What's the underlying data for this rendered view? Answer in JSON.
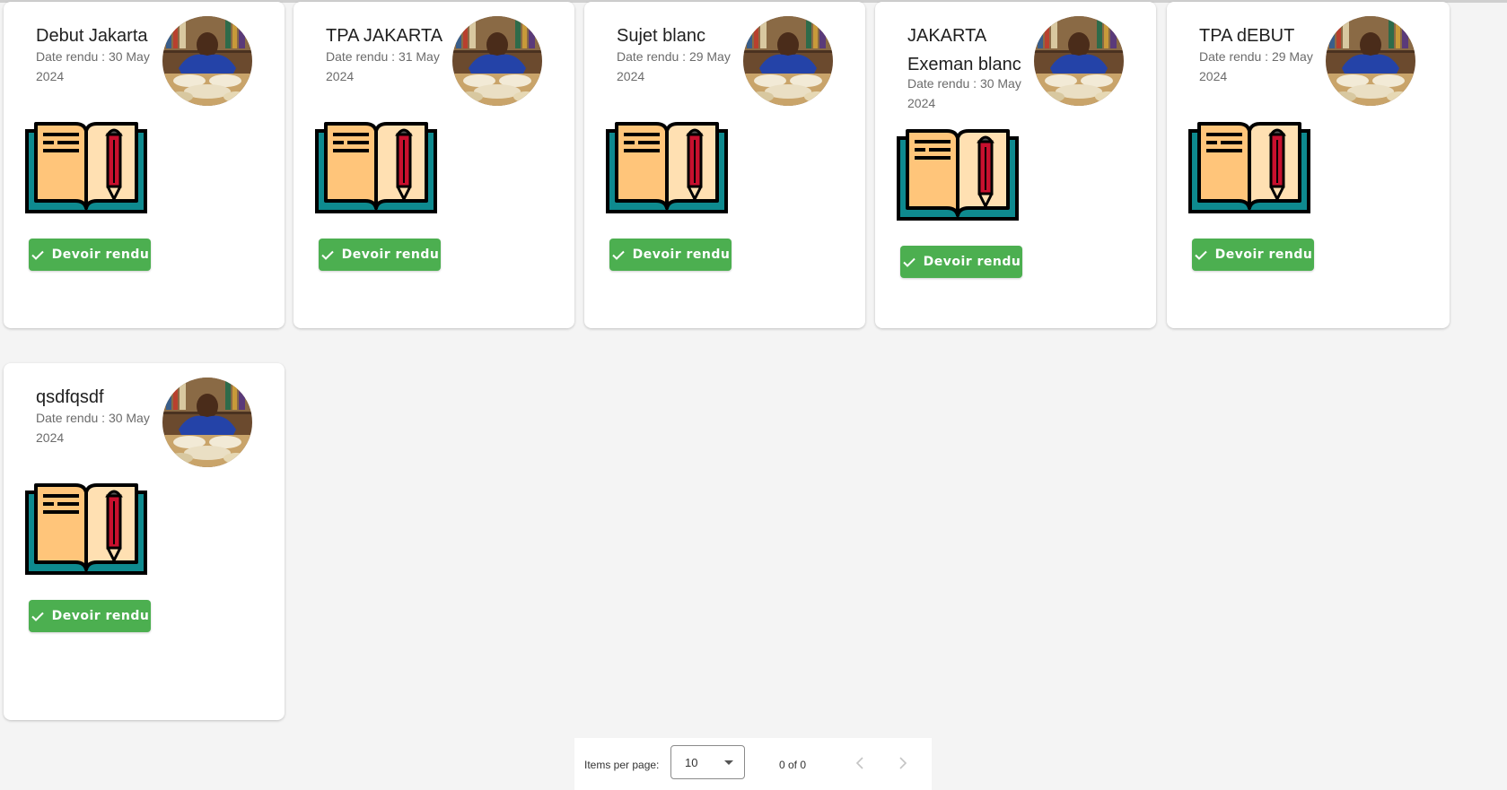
{
  "cards": [
    {
      "title": "Debut Jakarta",
      "date": "Date rendu : 30 May 2024",
      "button": "Devoir rendu"
    },
    {
      "title": "TPA JAKARTA",
      "date": "Date rendu : 31 May 2024",
      "button": "Devoir rendu"
    },
    {
      "title": "Sujet blanc",
      "date": "Date rendu : 29 May 2024",
      "button": "Devoir rendu"
    },
    {
      "title": "JAKARTA Exeman blanc",
      "date": "Date rendu : 30 May 2024",
      "button": "Devoir rendu"
    },
    {
      "title": "TPA dEBUT",
      "date": "Date rendu : 29 May 2024",
      "button": "Devoir rendu"
    },
    {
      "title": "qsdfqsdf",
      "date": "Date rendu : 30 May 2024",
      "button": "Devoir rendu"
    }
  ],
  "paginator": {
    "items_per_page_label": "Items per page:",
    "items_per_page_value": "10",
    "range_label": "0 of 0"
  },
  "icons": {
    "book": "open-book-with-pencil-icon",
    "check": "check-icon",
    "prev": "chevron-left-icon",
    "next": "chevron-right-icon",
    "dropdown": "dropdown-arrow-icon"
  },
  "colors": {
    "button": "#4caf50",
    "book_teal": "#0e8a8f",
    "book_page_left": "#ffc57a",
    "book_page_right": "#ffe0b2",
    "pencil": "#c8102e"
  }
}
